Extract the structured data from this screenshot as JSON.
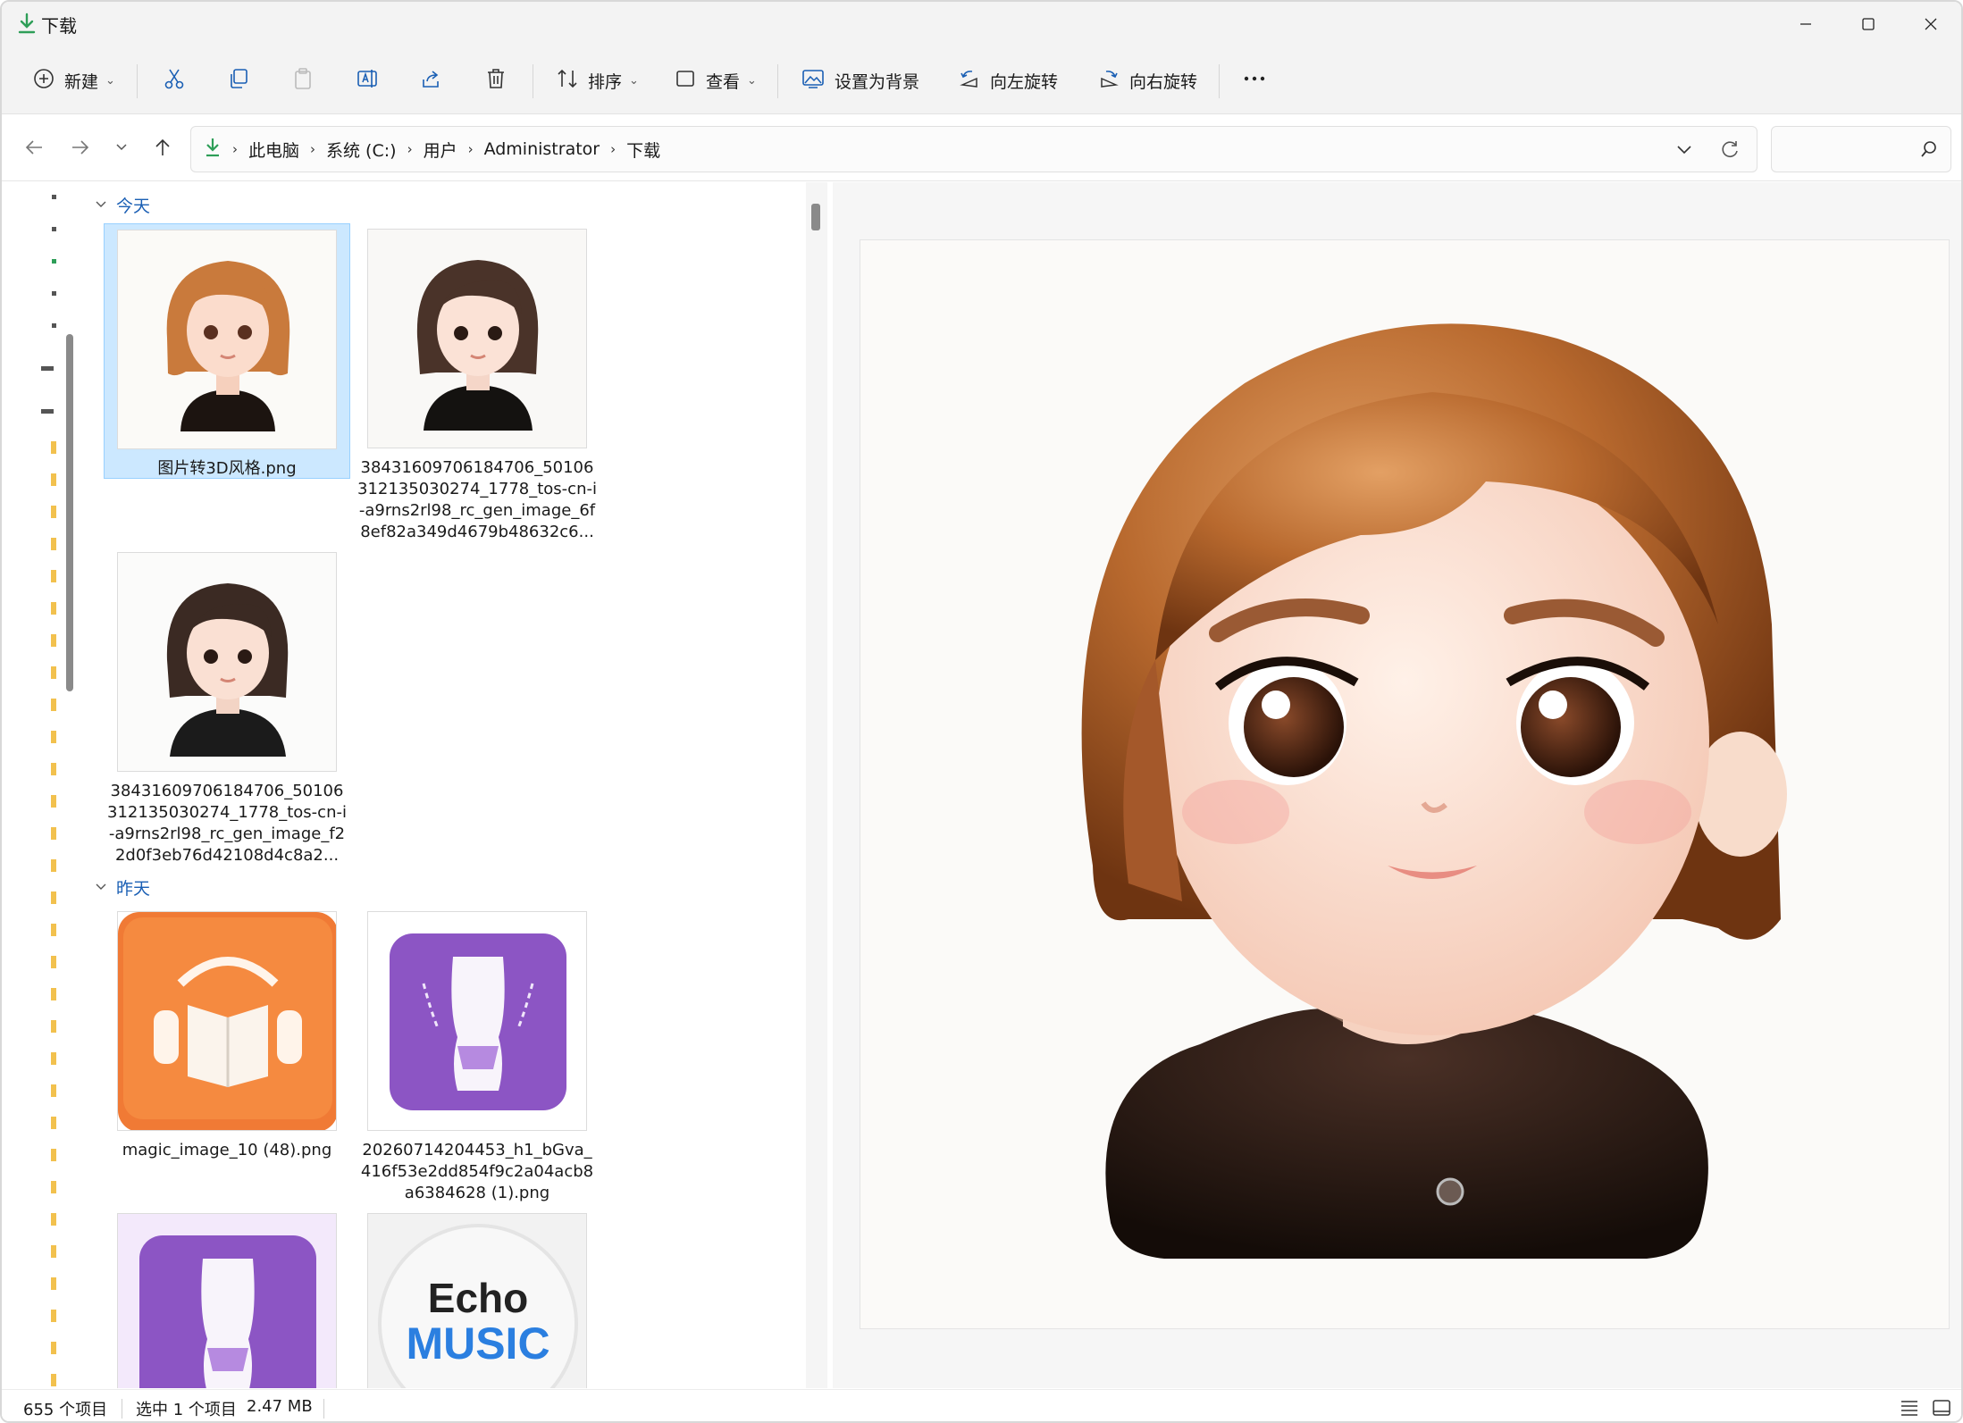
{
  "window": {
    "title": "下载"
  },
  "toolbar": {
    "new_label": "新建",
    "sort_label": "排序",
    "view_label": "查看",
    "set_background_label": "设置为背景",
    "rotate_left_label": "向左旋转",
    "rotate_right_label": "向右旋转"
  },
  "address": {
    "breadcrumbs": [
      "此电脑",
      "系统 (C:)",
      "用户",
      "Administrator",
      "下载"
    ]
  },
  "groups": [
    {
      "label": "今天"
    },
    {
      "label": "昨天"
    }
  ],
  "files": [
    {
      "name": "图片转3D风格.png",
      "selected": true
    },
    {
      "name": "38431609706184706_50106312135030274_1778_tos-cn-i-a9rns2rl98_rc_gen_image_6f8ef82a349d4679b48632c6..."
    },
    {
      "name": "38431609706184706_50106312135030274_1778_tos-cn-i-a9rns2rl98_rc_gen_image_f22d0f3eb76d42108d4c8a2..."
    },
    {
      "name": "magic_image_10 (48).png"
    },
    {
      "name": "20260714204453_h1_bGva_416f53e2dd854f9c2a04acb8a6384628 (1).png"
    }
  ],
  "thumb_text": {
    "echo": "Echo",
    "music": "MUSIC"
  },
  "status": {
    "count": "655 个项目",
    "selection": "选中 1 个项目",
    "size": "2.47 MB"
  },
  "colors": {
    "accent": "#1a5fb4",
    "selection": "#cce8ff",
    "download_green": "#2e9e58"
  }
}
